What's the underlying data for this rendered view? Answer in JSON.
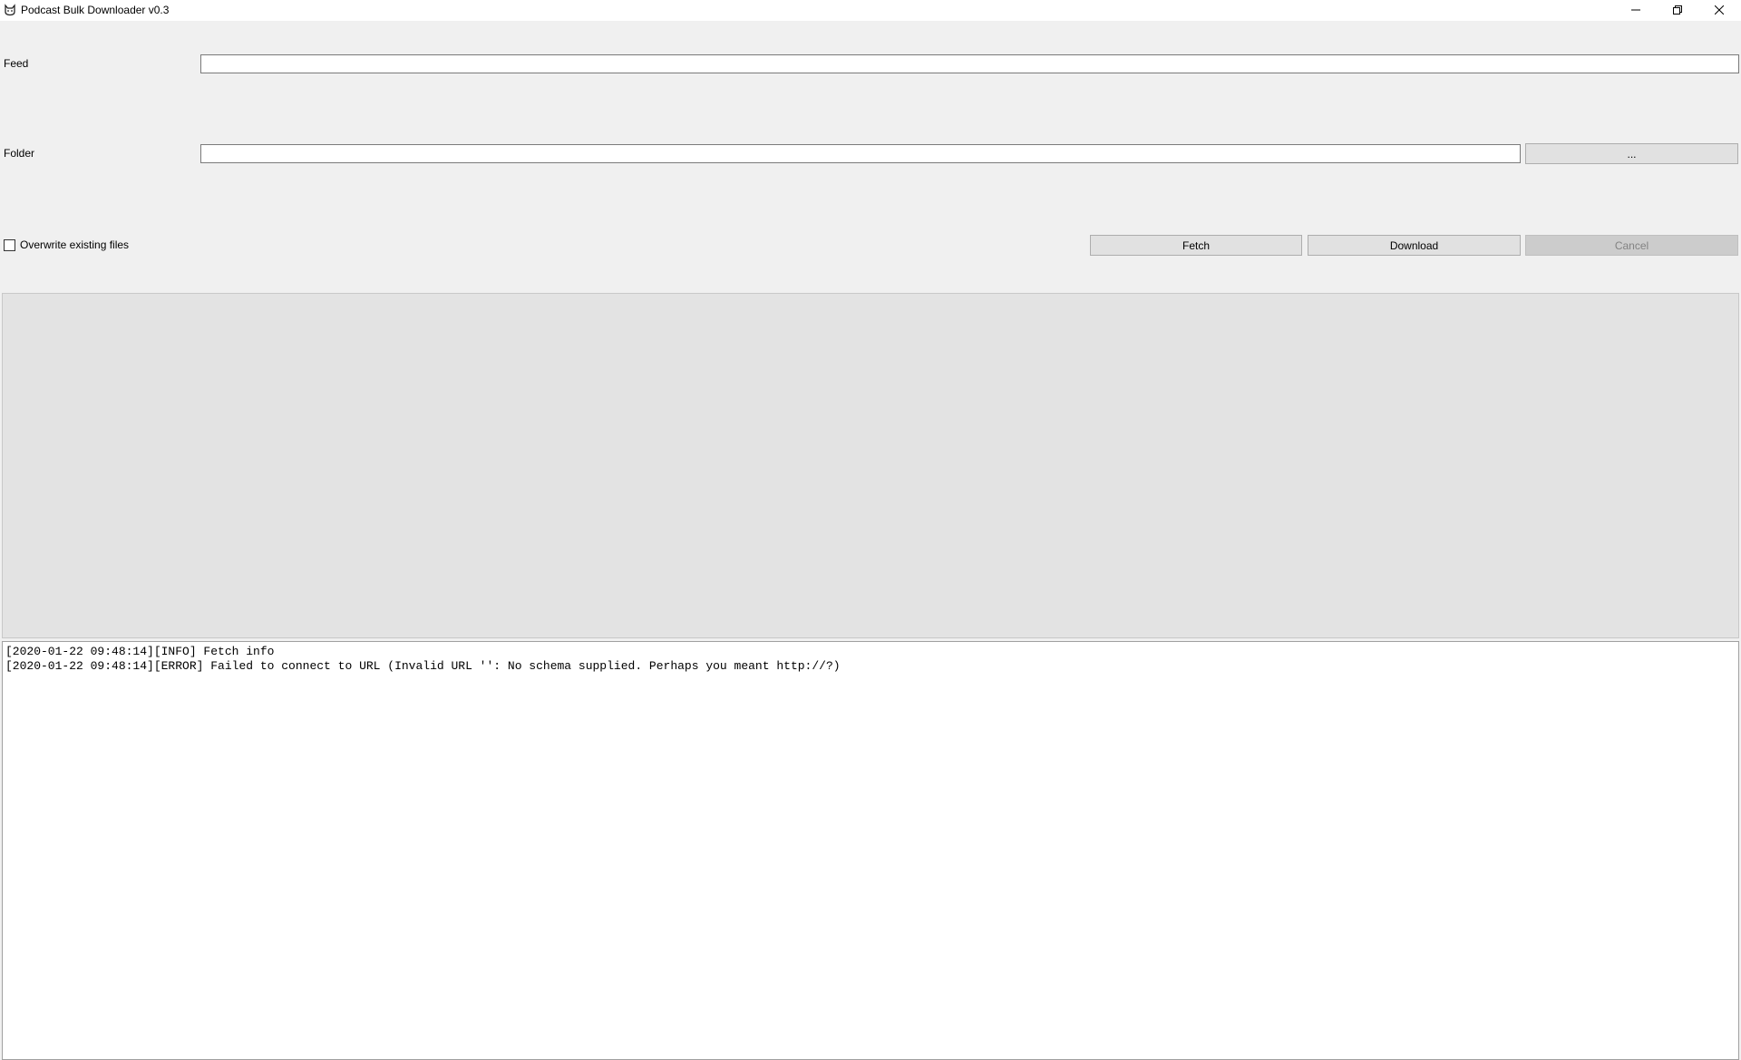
{
  "window": {
    "title": "Podcast Bulk Downloader v0.3",
    "app_icon": "cat-face-icon",
    "controls": {
      "minimize_icon": "minimize-icon",
      "restore_icon": "restore-icon",
      "close_icon": "close-icon"
    }
  },
  "form": {
    "feed_label": "Feed",
    "feed_value": "",
    "folder_label": "Folder",
    "folder_value": "",
    "browse_label": "...",
    "overwrite_label": "Overwrite existing files",
    "overwrite_checked": false
  },
  "actions": {
    "fetch_label": "Fetch",
    "download_label": "Download",
    "cancel_label": "Cancel",
    "cancel_enabled": false
  },
  "log": {
    "lines": [
      "[2020-01-22 09:48:14][INFO] Fetch info",
      "[2020-01-22 09:48:14][ERROR] Failed to connect to URL (Invalid URL '': No schema supplied. Perhaps you meant http://?)"
    ]
  },
  "colors": {
    "background": "#f0f0f0",
    "titlebar": "#ffffff",
    "button": "#e1e1e1",
    "button_disabled": "#cccccc",
    "episodes_panel": "#e3e3e3",
    "log_background": "#ffffff"
  }
}
